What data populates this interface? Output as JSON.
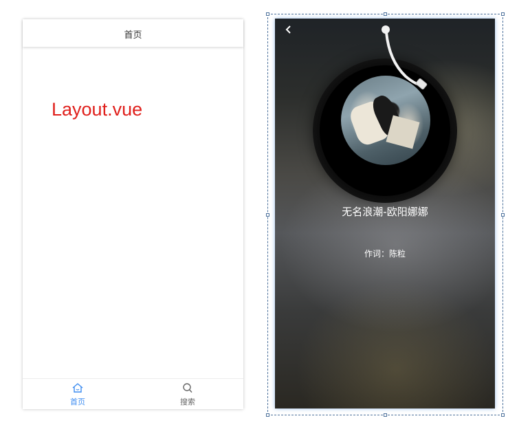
{
  "left_phone": {
    "header_title": "首页",
    "component_label": "Layout.vue",
    "tabbar": {
      "tabs": [
        {
          "label": "首页",
          "icon": "home-icon",
          "active": true
        },
        {
          "label": "搜索",
          "icon": "search-icon",
          "active": false
        }
      ]
    }
  },
  "player": {
    "back_icon": "chevron-left-icon",
    "song_title": "无名浪潮-欧阳娜娜",
    "lyric_line": "作词：陈粒"
  },
  "colors": {
    "label_red": "#e0201c",
    "tab_active": "#3d8cf0",
    "selection_border": "#4a6f9a"
  }
}
